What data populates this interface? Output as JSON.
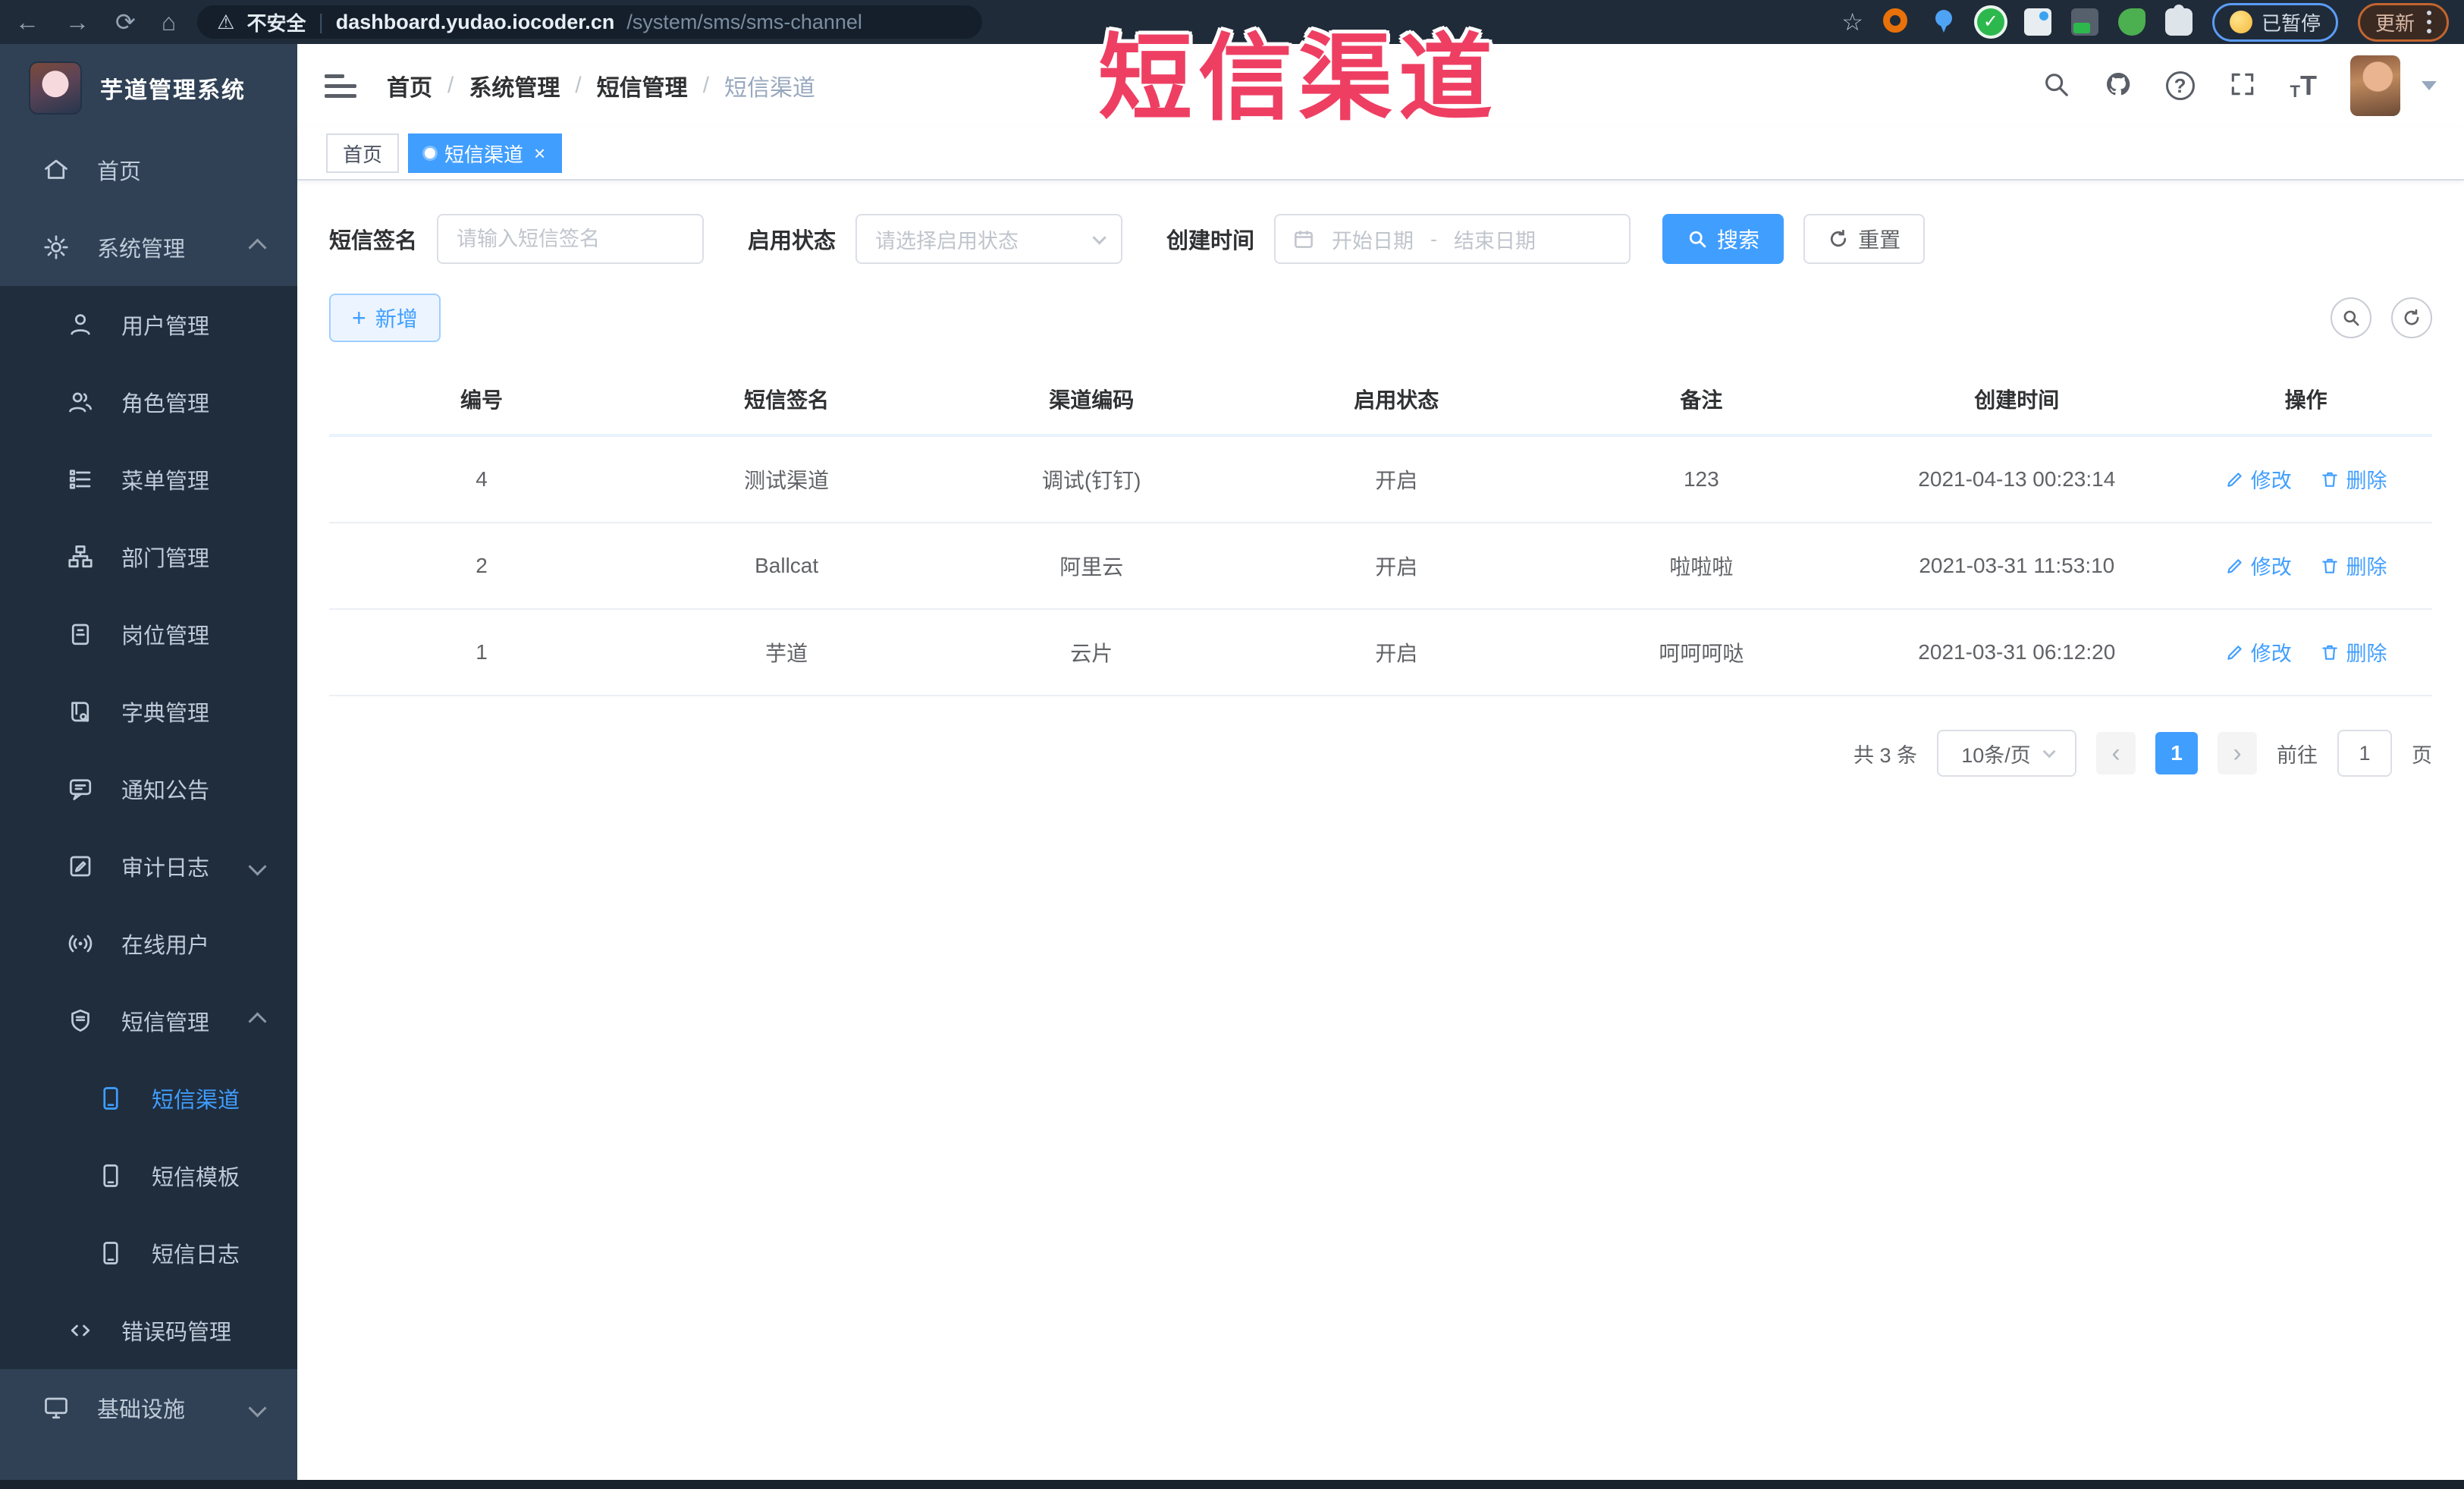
{
  "colors": {
    "accent": "#409eff",
    "sidebar_bg": "#304156",
    "submenu_bg": "#1f2d3d",
    "watermark": "#ee3f63"
  },
  "watermark": "短信渠道",
  "browser": {
    "security_label": "不安全",
    "url_host": "dashboard.yudao.iocoder.cn",
    "url_path": "/system/sms/sms-channel",
    "paused_label": "已暂停",
    "update_label": "更新"
  },
  "sidebar": {
    "logo_title": "芋道管理系统",
    "items": [
      {
        "label": "首页"
      },
      {
        "label": "系统管理"
      },
      {
        "label": "用户管理"
      },
      {
        "label": "角色管理"
      },
      {
        "label": "菜单管理"
      },
      {
        "label": "部门管理"
      },
      {
        "label": "岗位管理"
      },
      {
        "label": "字典管理"
      },
      {
        "label": "通知公告"
      },
      {
        "label": "审计日志"
      },
      {
        "label": "在线用户"
      },
      {
        "label": "短信管理"
      },
      {
        "label": "短信渠道"
      },
      {
        "label": "短信模板"
      },
      {
        "label": "短信日志"
      },
      {
        "label": "错误码管理"
      },
      {
        "label": "基础设施"
      }
    ]
  },
  "breadcrumb": {
    "separator": "/",
    "items": [
      "首页",
      "系统管理",
      "短信管理",
      "短信渠道"
    ]
  },
  "tabs": [
    {
      "label": "首页"
    },
    {
      "label": "短信渠道",
      "close": "×"
    }
  ],
  "search": {
    "sign_label": "短信签名",
    "sign_placeholder": "请输入短信签名",
    "status_label": "启用状态",
    "status_placeholder": "请选择启用状态",
    "time_label": "创建时间",
    "start_placeholder": "开始日期",
    "range_separator": "-",
    "end_placeholder": "结束日期",
    "search_label": "搜索",
    "reset_label": "重置"
  },
  "toolbar": {
    "add_label": "新增"
  },
  "table": {
    "headers": [
      "编号",
      "短信签名",
      "渠道编码",
      "启用状态",
      "备注",
      "创建时间",
      "操作"
    ],
    "edit_label": "修改",
    "delete_label": "删除",
    "rows": [
      {
        "id": "4",
        "signature": "测试渠道",
        "code": "调试(钉钉)",
        "status": "开启",
        "remark": "123",
        "created": "2021-04-13 00:23:14"
      },
      {
        "id": "2",
        "signature": "Ballcat",
        "code": "阿里云",
        "status": "开启",
        "remark": "啦啦啦",
        "created": "2021-03-31 11:53:10"
      },
      {
        "id": "1",
        "signature": "芋道",
        "code": "云片",
        "status": "开启",
        "remark": "呵呵呵哒",
        "created": "2021-03-31 06:12:20"
      }
    ]
  },
  "pagination": {
    "total": "共 3 条",
    "page_size": "10条/页",
    "prev": "‹",
    "page": "1",
    "next": "›",
    "goto_label": "前往",
    "goto_value": "1",
    "unit_label": "页"
  }
}
